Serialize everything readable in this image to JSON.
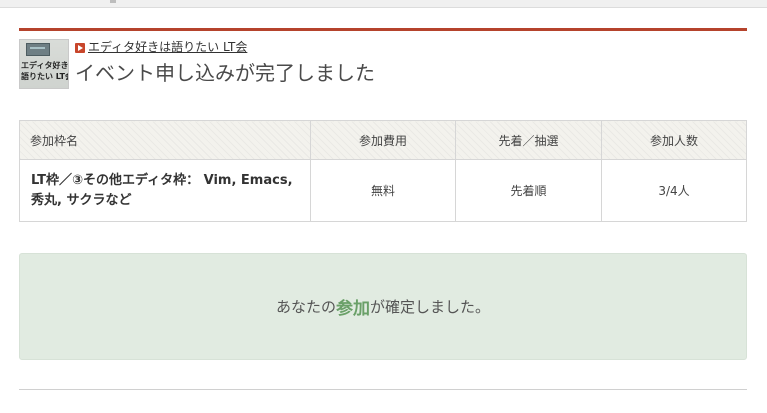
{
  "event": {
    "link_text": "エディタ好きは語りたい LT会",
    "thumbnail": {
      "line1": "エディタ好きは",
      "line2": "語りたい LT会"
    }
  },
  "page_title": "イベント申し込みが完了しました",
  "table": {
    "headers": [
      "参加枠名",
      "参加費用",
      "先着／抽選",
      "参加人数"
    ],
    "row": {
      "name": "LT枠／③その他エディタ枠： Vim, Emacs, 秀丸, サクラなど",
      "fee": "無料",
      "method": "先着順",
      "count": "3/4人"
    }
  },
  "confirmation": {
    "prefix": "あなたの",
    "highlight": "参加",
    "suffix": "が確定しました。"
  },
  "colors": {
    "accent": "#b5432c",
    "confirm_bg": "#e1ebe1",
    "confirm_highlight": "#6aa068"
  }
}
